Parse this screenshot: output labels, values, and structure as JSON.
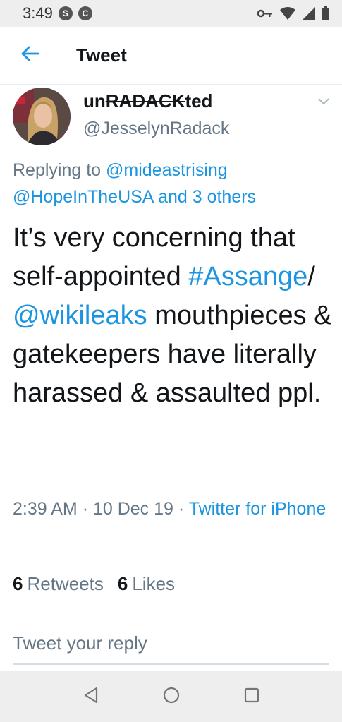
{
  "status_bar": {
    "time": "3:49",
    "badge1": "S",
    "badge2": "C",
    "icons": [
      "vpn-key-icon",
      "wifi-icon",
      "signal-icon",
      "battery-icon"
    ]
  },
  "app_bar": {
    "title": "Tweet",
    "back_icon": "arrow-left-icon"
  },
  "tweet": {
    "display_name_prefix": "un",
    "display_name_strike": "RADACK",
    "display_name_suffix": "ted",
    "handle": "@JesselynRadack",
    "reply_label": "Replying to",
    "reply_user1": "@mideastrising",
    "reply_user2": "@HopeInTheUSA",
    "reply_others": "and 3 others",
    "text_part1": "It’s very concerning that self-appointed",
    "hashtag": "#Assange",
    "text_sep": "/",
    "mention": "@wikileaks",
    "text_part2": "mouthpieces & gatekeepers have literally harassed & assaulted ppl.",
    "time": "2:39 AM",
    "date": "10 Dec 19",
    "source": "Twitter for iPhone",
    "dot": "·"
  },
  "stats": {
    "retweets_count": "6",
    "retweets_label": "Retweets",
    "likes_count": "6",
    "likes_label": "Likes"
  },
  "reply": {
    "placeholder": "Tweet your reply"
  },
  "colors": {
    "link": "#1b95e0",
    "text": "#14171a",
    "muted": "#657786"
  }
}
